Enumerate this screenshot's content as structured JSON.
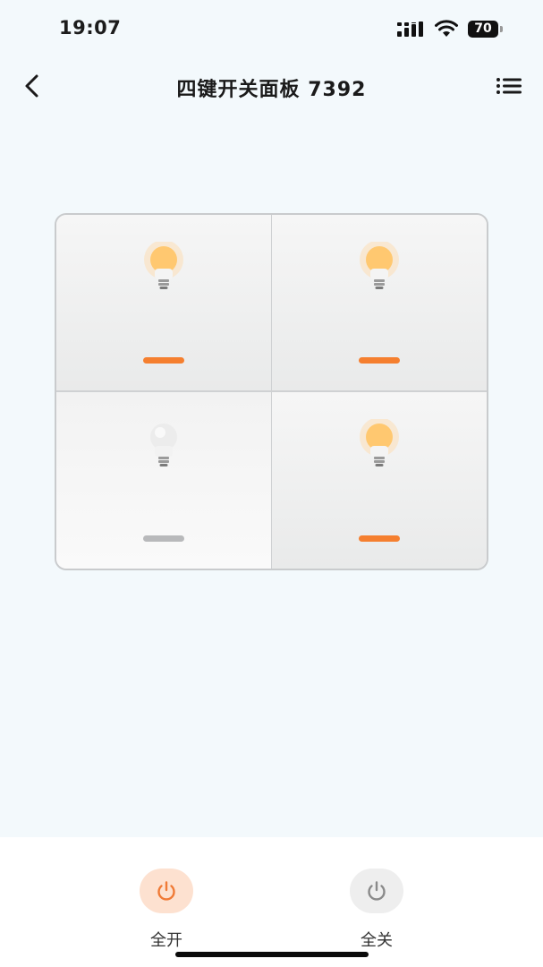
{
  "status_bar": {
    "time": "19:07",
    "battery_level": "70"
  },
  "header": {
    "title": "四键开关面板 7392"
  },
  "panel": {
    "keys": [
      {
        "state": "on"
      },
      {
        "state": "on"
      },
      {
        "state": "off"
      },
      {
        "state": "on"
      }
    ]
  },
  "bottom_bar": {
    "all_on_label": "全开",
    "all_off_label": "全关"
  },
  "colors": {
    "indicator_on": "#f57f2f",
    "indicator_off": "#b8b9bb",
    "all_on_accent": "#f07a36",
    "background": "#f3f9fc"
  },
  "icons": {
    "back": "chevron-left-icon",
    "menu": "list-menu-icon",
    "bulb_on": "lit-bulb-icon",
    "bulb_off": "unlit-bulb-icon",
    "power": "power-icon"
  }
}
